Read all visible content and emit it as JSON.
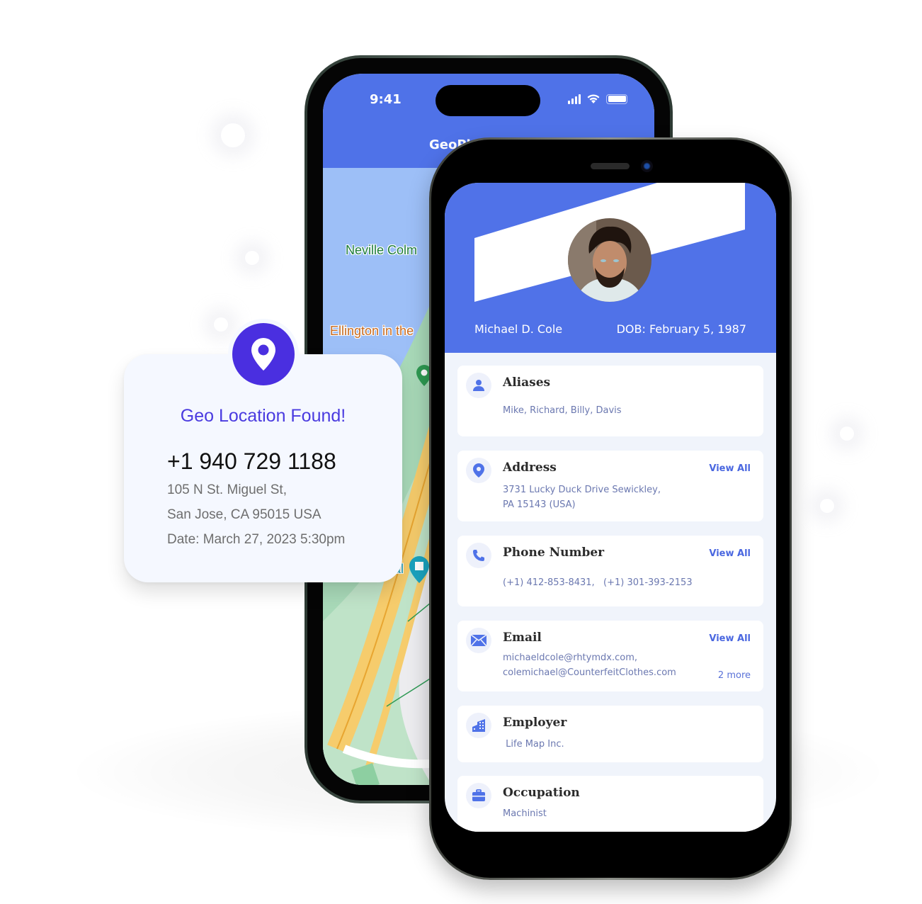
{
  "colors": {
    "header_blue": "#4f72e8",
    "geo_purple": "#4a2fe0",
    "link_blue": "#4a67e0",
    "card_text": "#6b78b0"
  },
  "back_phone": {
    "status": {
      "time": "9:41",
      "icons": [
        "signal-icon",
        "wifi-icon",
        "battery-icon"
      ]
    },
    "app_title": "GeoPl",
    "map": {
      "labels": [
        {
          "text": "Neville Colm",
          "color": "#1e7d3a"
        },
        {
          "text": "Ellington in the",
          "color": "#c86a1e"
        },
        {
          "text": "al",
          "color": "#1e9bb0"
        }
      ],
      "markers": [
        "map-pin-green-icon",
        "map-pin-museum-icon"
      ]
    }
  },
  "profile": {
    "name": "Michael D. Cole",
    "dob": "DOB: February 5, 1987",
    "cards": [
      {
        "id": "aliases",
        "icon": "person-icon",
        "title": "Aliases",
        "lines": [
          "Mike, Richard, Billy, Davis"
        ]
      },
      {
        "id": "address",
        "icon": "location-pin-icon",
        "title": "Address",
        "link": "View All",
        "lines": [
          "3731 Lucky Duck Drive Sewickley,",
          "PA 15143 (USA)"
        ]
      },
      {
        "id": "phone",
        "icon": "phone-icon",
        "title": "Phone Number",
        "link": "View All",
        "lines": [
          "(+1) 412-853-8431,   (+1) 301-393-2153"
        ]
      },
      {
        "id": "email",
        "icon": "envelope-icon",
        "title": "Email",
        "link": "View All",
        "lines": [
          "michaeldcole@rhtymdx.com,",
          "colemichael@CounterfeitClothes.com"
        ],
        "more": "2 more"
      },
      {
        "id": "employer",
        "icon": "building-icon",
        "title": "Employer",
        "lines": [
          " Life Map Inc."
        ]
      },
      {
        "id": "occupation",
        "icon": "briefcase-icon",
        "title": "Occupation",
        "lines": [
          "Machinist"
        ]
      }
    ]
  },
  "geo_popup": {
    "icon": "location-pin-icon",
    "title": "Geo Location Found!",
    "phone": "+1 940 729 1188",
    "address_line1": "105 N St. Miguel St,",
    "address_line2": "San Jose, CA 95015 USA",
    "date": "Date: March 27, 2023 5:30pm"
  }
}
